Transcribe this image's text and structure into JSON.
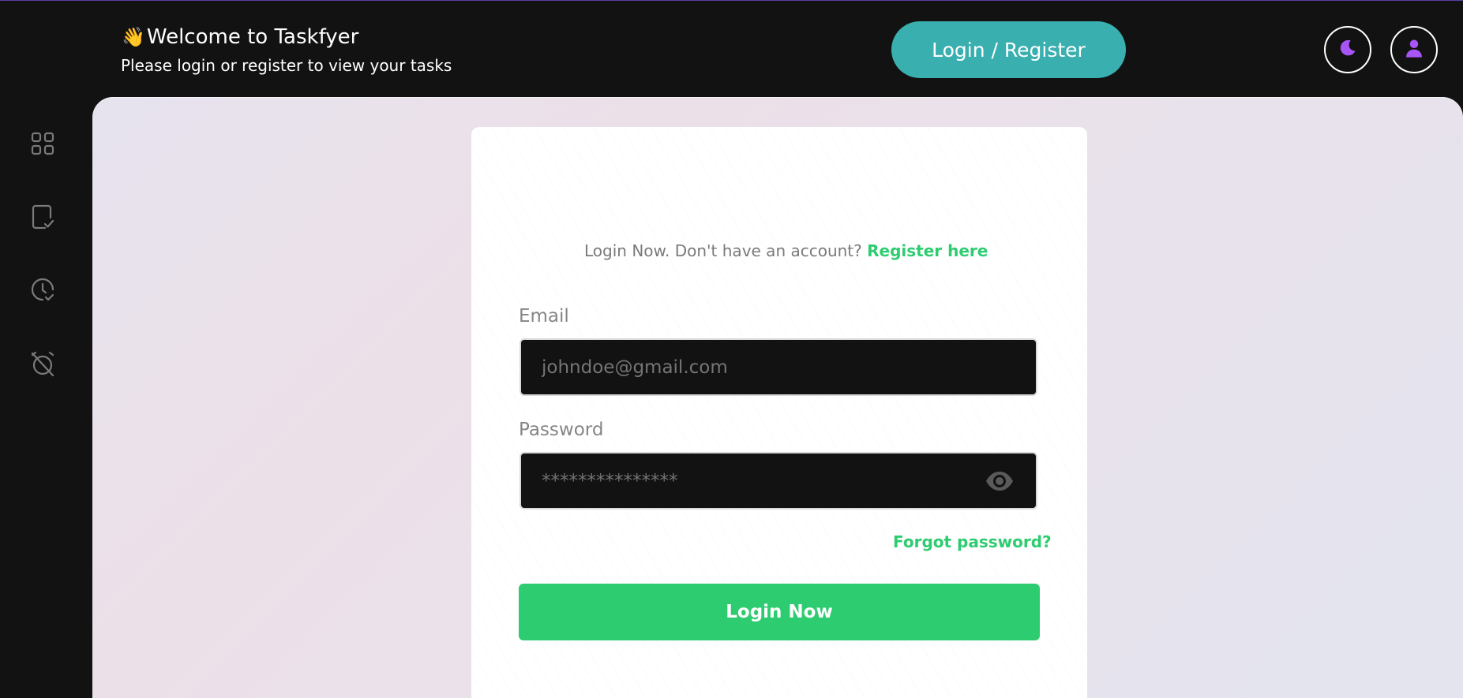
{
  "header": {
    "wave_emoji": "👋",
    "title": "Welcome to Taskfyer",
    "subtitle": "Please login or register to view your tasks",
    "login_register_label": "Login / Register"
  },
  "sidebar": {
    "items": [
      {
        "icon": "grid-icon"
      },
      {
        "icon": "task-check-icon"
      },
      {
        "icon": "clock-check-icon"
      },
      {
        "icon": "alarm-off-icon"
      }
    ]
  },
  "login_form": {
    "prompt_text": "Login Now. Don't have an account?",
    "register_link": "Register here",
    "email_label": "Email",
    "email_placeholder": "johndoe@gmail.com",
    "password_label": "Password",
    "password_placeholder": "***************",
    "forgot_password": "Forgot password?",
    "submit_label": "Login Now"
  },
  "colors": {
    "accent_teal": "#3aafb0",
    "accent_green": "#2ecc71",
    "accent_purple": "#a855f7",
    "background_dark": "#121212"
  }
}
